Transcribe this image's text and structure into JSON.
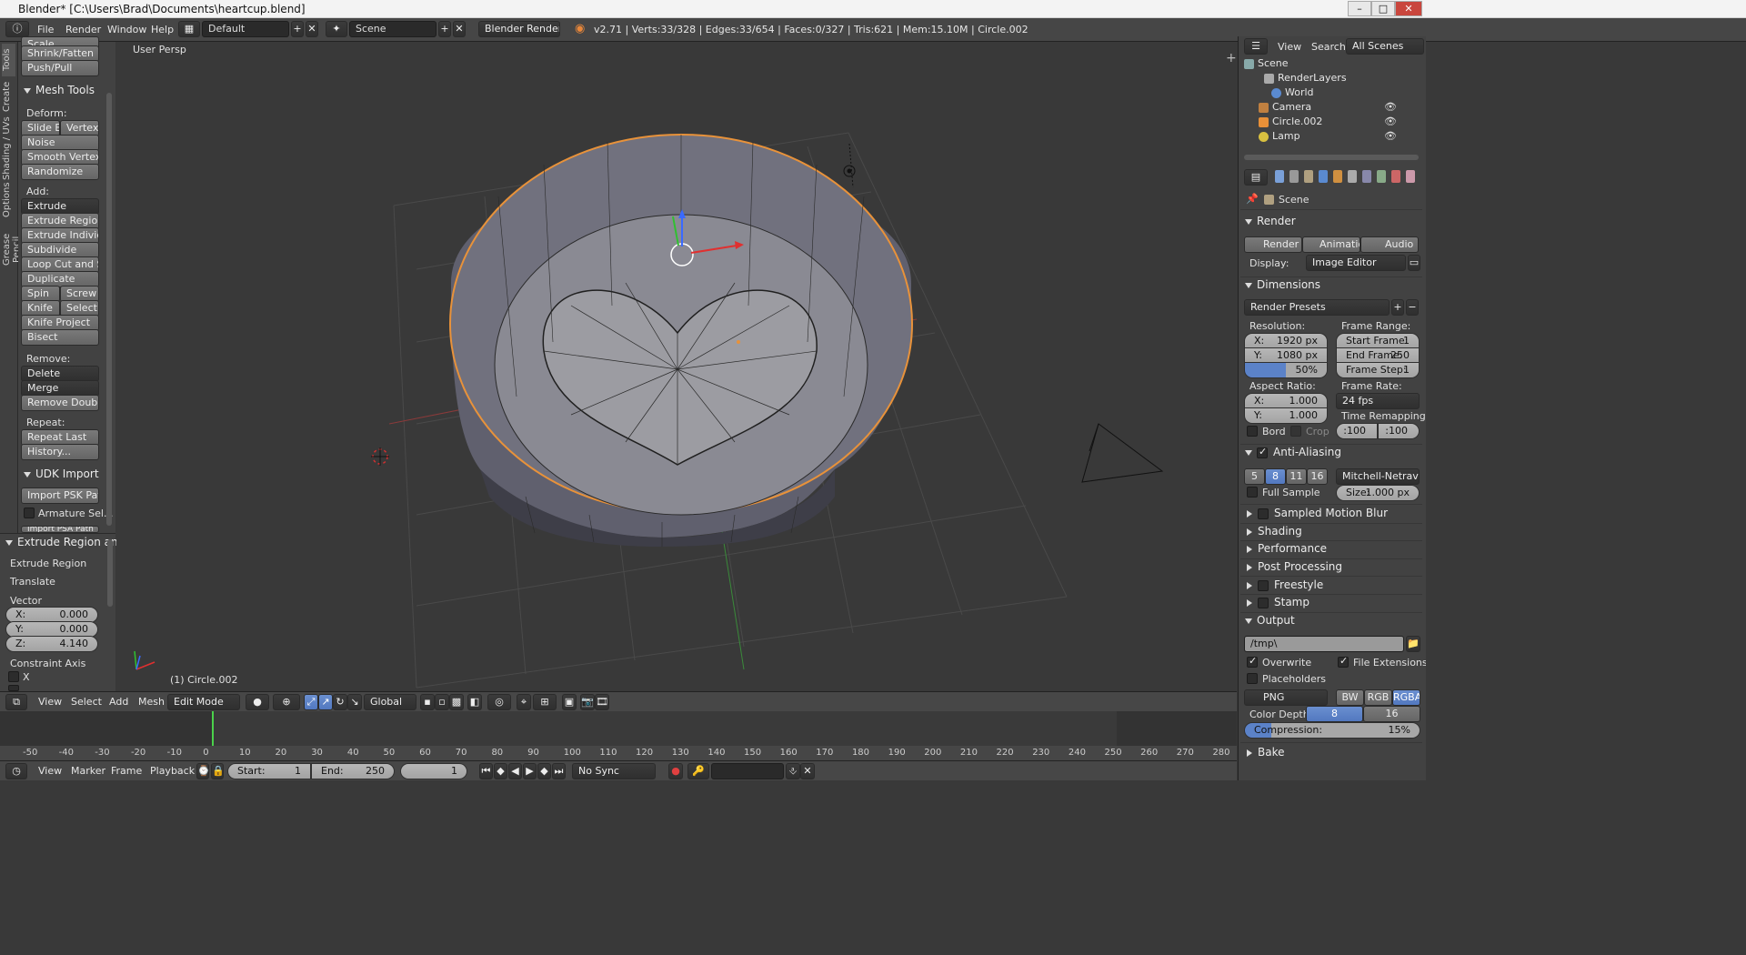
{
  "window": {
    "title": "Blender* [C:\\Users\\Brad\\Documents\\heartcup.blend]",
    "min": "–",
    "max": "□",
    "close": "✕"
  },
  "infobar": {
    "menus": [
      "File",
      "Render",
      "Window",
      "Help"
    ],
    "layout": "Default",
    "scene": "Scene",
    "engine": "Blender Render",
    "stats": "v2.71 | Verts:33/328 | Edges:33/654 | Faces:0/327 | Tris:621 | Mem:15.10M | Circle.002"
  },
  "lefttabs": [
    "Tools",
    "Create",
    "Shading / UVs",
    "Options",
    "Grease Pencil"
  ],
  "tools": {
    "top": [
      "Scale",
      "Shrink/Fatten",
      "Push/Pull"
    ],
    "mesh_tools": "Mesh Tools",
    "deform": "Deform:",
    "slide_edge": "Slide Ed",
    "vertex": "Vertex",
    "noise": "Noise",
    "smooth_vertex": "Smooth Vertex",
    "randomize": "Randomize",
    "add": "Add:",
    "extrude": "Extrude",
    "extrude_region": "Extrude Region",
    "extrude_individual": "Extrude Individual",
    "subdivide": "Subdivide",
    "loop_cut": "Loop Cut and Slide",
    "duplicate": "Duplicate",
    "spin": "Spin",
    "screw": "Screw",
    "knife": "Knife",
    "select": "Select",
    "knife_project": "Knife Project",
    "bisect": "Bisect",
    "remove": "Remove:",
    "delete": "Delete",
    "merge": "Merge",
    "remove_doubles": "Remove Doubles",
    "repeat": "Repeat:",
    "repeat_last": "Repeat Last",
    "history": "History...",
    "udk": "UDK Import",
    "import_psk": "Import PSK Path",
    "armature_sel": "Armature Sel...",
    "cut_off": "Import PSA Path"
  },
  "last_op": {
    "title": "Extrude Region and",
    "extrude_region": "Extrude Region",
    "translate": "Translate",
    "vector": "Vector",
    "x_label": "X:",
    "x": "0.000",
    "y_label": "Y:",
    "y": "0.000",
    "z_label": "Z:",
    "z": "4.140",
    "constraint": "Constraint Axis",
    "cx": "X",
    "cy": "Y"
  },
  "viewport": {
    "label": "User Persp",
    "object": "(1) Circle.002"
  },
  "vphead": {
    "view": "View",
    "select": "Select",
    "add": "Add",
    "mesh": "Mesh",
    "mode": "Edit Mode",
    "orientation": "Global"
  },
  "timeline": {
    "ticks": [
      "-50",
      "-40",
      "-30",
      "-20",
      "-10",
      "0",
      "10",
      "20",
      "30",
      "40",
      "50",
      "60",
      "70",
      "80",
      "90",
      "100",
      "110",
      "120",
      "130",
      "140",
      "150",
      "160",
      "170",
      "180",
      "190",
      "200",
      "210",
      "220",
      "230",
      "240",
      "250",
      "260",
      "270",
      "280"
    ],
    "view": "View",
    "marker": "Marker",
    "frame": "Frame",
    "playback": "Playback",
    "start_label": "Start:",
    "start": "1",
    "end_label": "End:",
    "end": "250",
    "current": "1",
    "sync": "No Sync"
  },
  "outliner": {
    "view": "View",
    "search": "Search",
    "filter": "All Scenes",
    "items": [
      "Scene",
      "RenderLayers",
      "World",
      "Camera",
      "Circle.002",
      "Lamp"
    ]
  },
  "props": {
    "scene": "Scene",
    "render": "Render",
    "render_btn": "Render",
    "animation_btn": "Animation",
    "audio_btn": "Audio",
    "display_label": "Display:",
    "display": "Image Editor",
    "dimensions": "Dimensions",
    "presets": "Render Presets",
    "resolution": "Resolution:",
    "res_x_label": "X:",
    "res_x": "1920 px",
    "res_y_label": "Y:",
    "res_y": "1080 px",
    "res_pct": "50%",
    "frame_range": "Frame Range:",
    "start_label": "Start Frame:",
    "start": "1",
    "end_label": "End Frame:",
    "end": "250",
    "step_label": "Frame Step:",
    "step": "1",
    "aspect": "Aspect Ratio:",
    "asp_x_label": "X:",
    "asp_x": "1.000",
    "asp_y_label": "Y:",
    "asp_y": "1.000",
    "frame_rate": "Frame Rate:",
    "fps": "24 fps",
    "time_remap": "Time Remapping:",
    "remap_old": ":100",
    "remap_new": ":100",
    "bord": "Bord",
    "crop": "Crop",
    "aa": "Anti-Aliasing",
    "aa5": "5",
    "aa8": "8",
    "aa11": "11",
    "aa16": "16",
    "filter": "Mitchell-Netravali",
    "full_sample": "Full Sample",
    "size_label": "Size:",
    "size": "1.000 px",
    "motion_blur": "Sampled Motion Blur",
    "shading": "Shading",
    "performance": "Performance",
    "post": "Post Processing",
    "freestyle": "Freestyle",
    "stamp": "Stamp",
    "output": "Output",
    "path": "/tmp\\",
    "overwrite": "Overwrite",
    "file_ext": "File Extensions",
    "placeholders": "Placeholders",
    "format": "PNG",
    "bw": "BW",
    "rgb": "RGB",
    "rgba": "RGBA",
    "color_depth": "Color Depth:",
    "cd8": "8",
    "cd16": "16",
    "compression_label": "Compression:",
    "compression": "15%",
    "compression_value": 15,
    "bake": "Bake"
  }
}
